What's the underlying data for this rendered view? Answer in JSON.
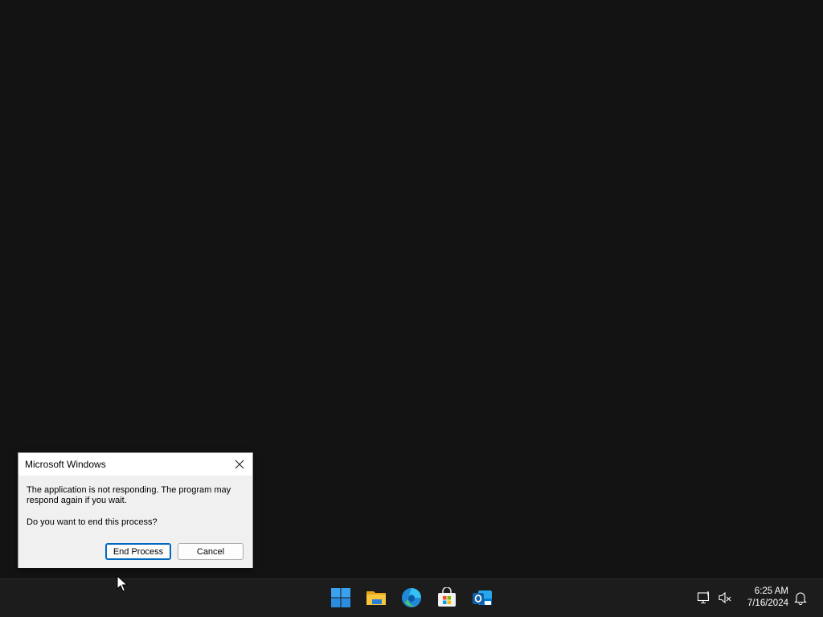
{
  "dialog": {
    "title": "Microsoft Windows",
    "message": "The application is not responding. The program may respond again if you wait.",
    "question": "Do you want to end this process?",
    "end_process_label": "End Process",
    "cancel_label": "Cancel",
    "close_icon": "close-icon"
  },
  "taskbar": {
    "apps": [
      {
        "name": "start-button",
        "icon": "windows-logo-icon"
      },
      {
        "name": "file-explorer",
        "icon": "folder-icon"
      },
      {
        "name": "microsoft-edge",
        "icon": "edge-icon"
      },
      {
        "name": "microsoft-store",
        "icon": "store-icon"
      },
      {
        "name": "outlook",
        "icon": "outlook-icon"
      }
    ],
    "tray": {
      "network_icon": "network-disconnected-icon",
      "volume_icon": "volume-muted-icon",
      "notification_icon": "bell-icon"
    },
    "time": "6:25 AM",
    "date": "7/16/2024"
  },
  "colors": {
    "desktop": "#131313",
    "taskbar": "#1c1c1c",
    "accent": "#0067c0",
    "dialog_bg": "#f0f0f0"
  }
}
